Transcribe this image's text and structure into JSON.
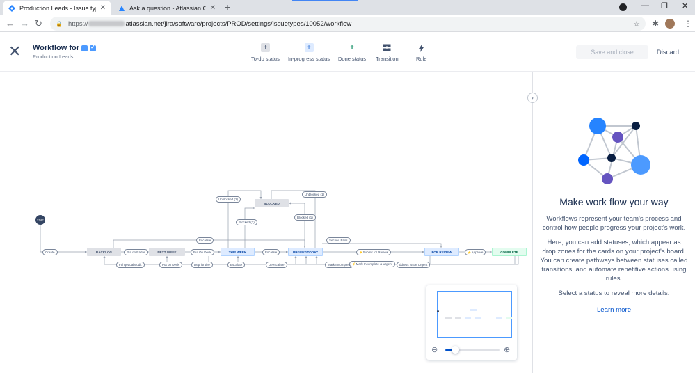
{
  "browser": {
    "tabs": [
      {
        "title": "Production Leads - Issue types -",
        "active": true,
        "favicon": "jira-icon"
      },
      {
        "title": "Ask a question - Atlassian Comm",
        "active": false,
        "favicon": "atlassian-icon"
      }
    ],
    "url_prefix": "https://",
    "url_rest": "atlassian.net/jira/software/projects/PROD/settings/issuetypes/10052/workflow"
  },
  "header": {
    "title": "Workflow for",
    "subtitle": "Production Leads",
    "tools": [
      {
        "label": "To-do status",
        "icon": "plus-icon"
      },
      {
        "label": "In-progress status",
        "icon": "plus-icon"
      },
      {
        "label": "Done status",
        "icon": "plus-icon"
      },
      {
        "label": "Transition",
        "icon": "transition-icon"
      },
      {
        "label": "Rule",
        "icon": "lightning-icon"
      }
    ],
    "save_label": "Save and close",
    "discard_label": "Discard"
  },
  "diagram": {
    "start_label": "START",
    "statuses": {
      "backlog": "BACKLOG",
      "next_week": "NEXT WEEK",
      "this_week": "THIS WEEK",
      "urgent": "URGENT/TODAY",
      "for_review": "FOR REVIEW",
      "complete": "COMPLETE",
      "blocked": "BLOCKED"
    },
    "transitions": {
      "create": "Create",
      "put_on_radar": "Put on Radar",
      "put_on_deck_1": "Put On Deck",
      "escalate_1": "Escalate",
      "submit_review": "Submit for Review",
      "approve": "Approve",
      "escalate_top": "Escalate",
      "second_pass": "Second Pass",
      "unblocked_2": "Unblocked (2)",
      "unblocked_1": "Unblocked (1)",
      "blocked_2": "Blocked (2)",
      "blocked_1": "Blocked (1)",
      "fuhgeddaboudit": "Fuhgeddaboudit",
      "put_on_deck_2": "Put on Deck",
      "deprioritize": "Deprioritize",
      "escalate_bottom": "Escalate",
      "deescalate": "Deescalate",
      "mark_incomplete": "Mark Incomplete",
      "mark_incomplete_urgent": "Mark Incomplete & Urgent",
      "address_urgent": "ddress Issue Urgent"
    }
  },
  "panel": {
    "title": "Make work flow your way",
    "p1": "Workflows represent your team's process and control how people progress your project's work.",
    "p2": "Here, you can add statuses, which appear as drop zones for the cards on your project's board. You can create pathways between statuses called transitions, and automate repetitive actions using rules.",
    "p3": "Select a status to reveal more details.",
    "learn_more": "Learn more"
  },
  "minimap": {
    "zoom_level": 0.18
  },
  "colors": {
    "accent": "#0052cc",
    "todo": "#dfe1e6",
    "in_progress": "#deebff",
    "done": "#e3fcef"
  }
}
